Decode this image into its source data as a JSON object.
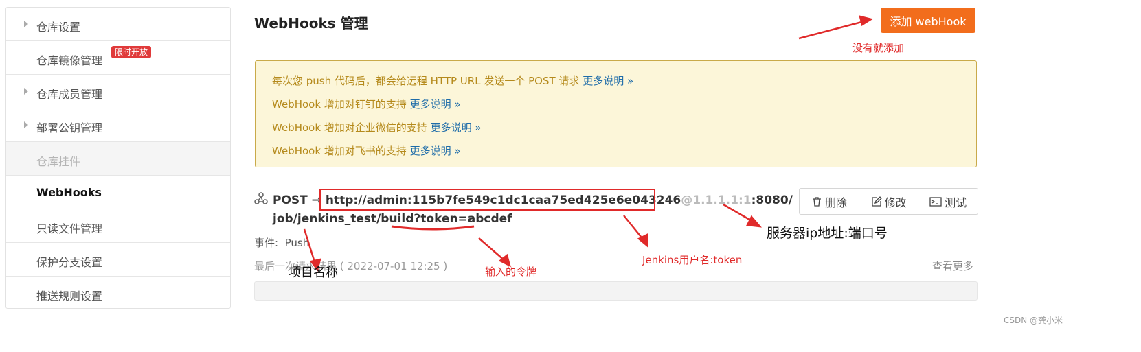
{
  "sidebar": {
    "items": [
      {
        "label": "仓库设置"
      },
      {
        "label": "仓库镜像管理",
        "badge": "限时开放"
      },
      {
        "label": "仓库成员管理"
      },
      {
        "label": "部署公钥管理"
      },
      {
        "label": "仓库挂件"
      },
      {
        "label": "WebHooks"
      },
      {
        "label": "只读文件管理"
      },
      {
        "label": "保护分支设置"
      },
      {
        "label": "推送规则设置"
      }
    ]
  },
  "main": {
    "title": "WebHooks 管理",
    "add_button": "添加 webHook",
    "notice": [
      {
        "text": "每次您 push 代码后，都会给远程 HTTP URL 发送一个 POST 请求 ",
        "link": "更多说明 »"
      },
      {
        "text": "WebHook 增加对钉钉的支持 ",
        "link": "更多说明 »"
      },
      {
        "text": "WebHook 增加对企业微信的支持 ",
        "link": "更多说明 »"
      },
      {
        "text": "WebHook 增加对飞书的支持 ",
        "link": "更多说明 »"
      }
    ],
    "hook": {
      "method": "POST → ",
      "url_highlighted": "http://admin:115b7fe549c1dc1caa75ed425e6e043246",
      "url_masked": "@1.1.1.1:1",
      "url_rest": ":8080/job/jenkins_test/build?token=abcdef",
      "actions": {
        "delete": "删除",
        "edit": "修改",
        "test": "测试"
      },
      "events_label": "事件:",
      "events_value": "Push",
      "last_result": "最后一次请求结果 ( 2022-07-01 12:25 )",
      "view_more": "查看更多"
    }
  },
  "annotations": {
    "add_note": "没有就添加",
    "ip_note": "服务器ip地址:端口号",
    "project_note": "项目名称",
    "token_note": "输入的令牌",
    "jenkins_note": "Jenkins用户名:token"
  },
  "watermark": "CSDN @龚小米",
  "colors": {
    "accent": "#f26d1c",
    "annotation": "#e02a2a",
    "notice_text": "#b58a1c",
    "link": "#1e6ca9"
  }
}
